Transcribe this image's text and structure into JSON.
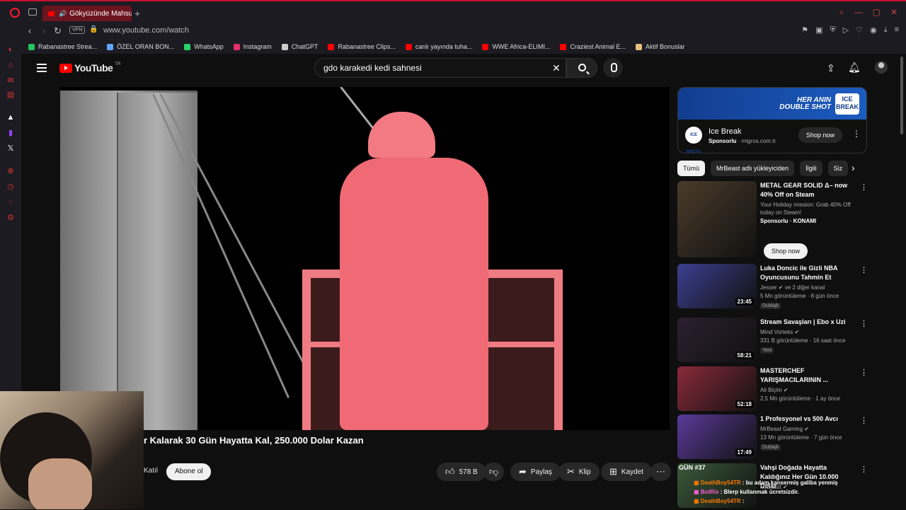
{
  "browser": {
    "tab_title": "Gökyüzünde Mahsur K",
    "url": "www.youtube.com/watch",
    "vpn_label": "VPN",
    "bookmarks": [
      {
        "label": "Rabanastree Strea...",
        "color": "#22c55e"
      },
      {
        "label": "ÖZEL ORAN BON...",
        "color": "#60a5fa"
      },
      {
        "label": "WhatsApp",
        "color": "#25d366"
      },
      {
        "label": "Instagram",
        "color": "#e1306c"
      },
      {
        "label": "ChatGPT",
        "color": "#cccccc"
      },
      {
        "label": "Rabanastree Clips...",
        "color": "#ff0000"
      },
      {
        "label": "canlı yayında tuha...",
        "color": "#ff0000"
      },
      {
        "label": "WWE Africa-ELIMI...",
        "color": "#ff0000"
      },
      {
        "label": "Craziest Animal E...",
        "color": "#ff0000"
      },
      {
        "label": "Aktif Bonuslar",
        "color": "#e5c07b"
      }
    ]
  },
  "header": {
    "logo_text": "YouTube",
    "logo_country": "TR",
    "search_query": "gdo karakedi kedi sahnesi"
  },
  "video": {
    "title": "r Kalarak 30 Gün Hayatta Kal, 250.000 Dolar Kazan",
    "join_label": "Katıl",
    "subscribe_label": "Abone ol",
    "like_count": "578 B",
    "share_label": "Paylaş",
    "clip_label": "Klip",
    "save_label": "Kaydet"
  },
  "ad": {
    "banner_line1": "HER ANIN",
    "banner_line2": "DOUBLE SHOT",
    "brand_badge": "ICE BREAK",
    "name": "Ice Break",
    "sponsored": "Sponsorlu",
    "domain": "· migros.com.tr",
    "cta": "Shop now"
  },
  "chips": [
    "Tümü",
    "MrBeast adlı yükleyiciden",
    "İlgili",
    "Siz"
  ],
  "recommendations": [
    {
      "title": "METAL GEAR SOLID Δ– now 40% Off on Steam",
      "channel": "Your Holiday mission: Grab 40% Off today on Steam!",
      "meta": "Sponsorlu · KONAMI",
      "duration": "",
      "badge": "",
      "cta": "Shop now",
      "thumb_color": "#4a3b2a"
    },
    {
      "title": "Luka Doncic ile Gizli NBA Oyuncusunu Tahmin Et",
      "channel": "Jesser ✔ ve 2 diğer kanal",
      "meta": "5 Mn görüntüleme · 8 gün önce",
      "duration": "23:45",
      "badge": "Dublajlı",
      "thumb_color": "#3b3f8f"
    },
    {
      "title": "Stream Savaşları | Ebo x Uzi",
      "channel": "Mind Vorteks ✔",
      "meta": "331 B görüntüleme · 16 saat önce",
      "duration": "58:21",
      "badge": "Yeni",
      "thumb_color": "#2b1f2f"
    },
    {
      "title": "MASTERCHEF YARIŞMACILARININ ...",
      "channel": "Ali Biçim ✔",
      "meta": "2,5 Mn görüntüleme · 1 ay önce",
      "duration": "52:18",
      "badge": "",
      "thumb_color": "#8a2a3a"
    },
    {
      "title": "1 Profesyonel vs 500 Avcı",
      "channel": "MrBeast Gaming ✔",
      "meta": "13 Mn görüntüleme · 7 gün önce",
      "duration": "17:49",
      "badge": "Dublajlı",
      "thumb_color": "#5a3a9a"
    },
    {
      "title": "Vahşi Doğada Hayatta Kaldığınız Her Gün 10.000 Dolar",
      "channel": "MrBeast ✔",
      "meta": "",
      "duration": "",
      "badge": "",
      "thumb_color": "#3a5a3a"
    }
  ],
  "rec_overlay_label": "GÜN #37",
  "chat": [
    {
      "user": "DeathBoy54TR",
      "text": ": bu adam kansermiş galiba yenmiş"
    },
    {
      "user": "BotRix",
      "text": ": Blerp kullanmak ücretsizdir."
    },
    {
      "user": "DeathBoy54TR",
      "text": ":"
    }
  ]
}
